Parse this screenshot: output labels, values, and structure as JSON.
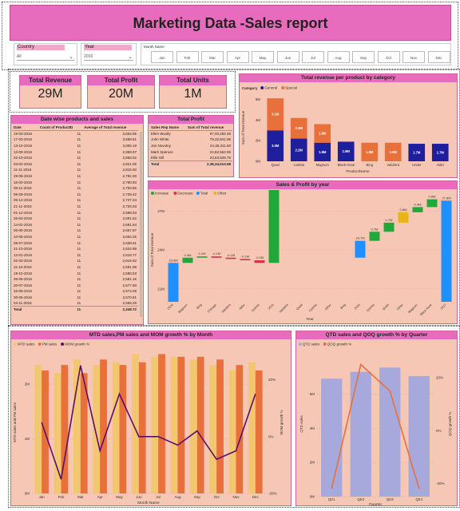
{
  "title": "Marketing Data -Sales report",
  "slicers": {
    "country": {
      "label": "Country",
      "value": "All"
    },
    "year": {
      "label": "Year",
      "value": "2016"
    },
    "month": {
      "label": "Month Name",
      "items": [
        "Jan",
        "Feb",
        "Mar",
        "Apr",
        "May",
        "Jun",
        "Jul",
        "Aug",
        "Sep",
        "Oct",
        "Nov",
        "Dec"
      ]
    }
  },
  "kpis": [
    {
      "label": "Total Revenue",
      "value": "29M"
    },
    {
      "label": "Total Profit",
      "value": "20M"
    },
    {
      "label": "Total Units",
      "value": "1M"
    }
  ],
  "date_table": {
    "title": "Date wise products and sales",
    "columns": [
      "Date",
      "Count of ProductID",
      "Average of Total revenue"
    ],
    "rows": [
      [
        "19-03-2016",
        "11",
        "3,664.55"
      ],
      [
        "17-03-2016",
        "11",
        "3,658.61"
      ],
      [
        "13-10-2016",
        "11",
        "3,006.19"
      ],
      [
        "13-09-2016",
        "11",
        "2,958.97"
      ],
      [
        "02-10-2016",
        "11",
        "2,858.02"
      ],
      [
        "03-02-2016",
        "11",
        "2,821.05"
      ],
      [
        "11-11-2016",
        "11",
        "2,815.50"
      ],
      [
        "29-08-2016",
        "11",
        "2,782.30"
      ],
      [
        "16-03-2016",
        "11",
        "2,780.93"
      ],
      [
        "08-11-2016",
        "11",
        "2,763.55"
      ],
      [
        "05-09-2016",
        "11",
        "2,739.42"
      ],
      [
        "05-12-2016",
        "11",
        "2,727.34"
      ],
      [
        "21-11-2016",
        "11",
        "2,726.03"
      ],
      [
        "01-12-2016",
        "11",
        "2,698.53"
      ],
      [
        "26-02-2016",
        "11",
        "2,691.52"
      ],
      [
        "14-01-2016",
        "11",
        "2,681.64"
      ],
      [
        "06-05-2016",
        "11",
        "2,667.87"
      ],
      [
        "10-05-2016",
        "11",
        "2,654.25"
      ],
      [
        "08-07-2016",
        "11",
        "2,638.61"
      ],
      [
        "21-10-2016",
        "11",
        "2,624.88"
      ],
      [
        "12-01-2016",
        "11",
        "2,619.77"
      ],
      [
        "02-03-2016",
        "11",
        "2,616.82"
      ],
      [
        "11-10-2016",
        "11",
        "2,591.08"
      ],
      [
        "19-10-2016",
        "11",
        "2,580.53"
      ],
      [
        "06-06-2016",
        "11",
        "2,581.16"
      ],
      [
        "20-07-2016",
        "11",
        "2,577.90"
      ],
      [
        "16-08-2016",
        "11",
        "2,574.08"
      ],
      [
        "30-05-2016",
        "11",
        "2,570.81"
      ],
      [
        "04-11-2016",
        "11",
        "2,566.29"
      ]
    ],
    "total": [
      "Total",
      "11",
      "2,348.72"
    ]
  },
  "profit_table": {
    "title": "Total Profit",
    "columns": [
      "Sales Rep Name",
      "Sum of Total revenue"
    ],
    "rows": [
      [
        "Ellen Woolly",
        "97,00,259.35"
      ],
      [
        "John White",
        "79,32,841.55"
      ],
      [
        "Jan Novotny",
        "24,35,311.60"
      ],
      [
        "Mark Spencer",
        "24,82,562.95"
      ],
      [
        "Ellie Gill",
        "23,63,528.75"
      ]
    ],
    "total": [
      "Total",
      "2,38,34,513.58"
    ]
  },
  "charts": {
    "category": {
      "title": "Total revenue per product by category",
      "legend_title": "Category",
      "legend": [
        "General",
        "Special"
      ],
      "xlabel": "ProductName",
      "ylabel": "Sum of Total revenue",
      "ticks": [
        "0M",
        "2M",
        "4M",
        "6M"
      ],
      "colors": {
        "General": "#1f1f9e",
        "Special": "#e8703a"
      }
    },
    "waterfall": {
      "title": "Sales & Profit by year",
      "legend": [
        "Increase",
        "Decrease",
        "Total",
        "Other"
      ],
      "xlabel": "Year",
      "ylabel": "Sum of Total revenue",
      "ticks": [
        "21M",
        "24M",
        "27M"
      ],
      "colors": {
        "Increase": "#22a839",
        "Decrease": "#d9334a",
        "Total": "#1e90ff",
        "Other": "#e8b41a"
      }
    },
    "month": {
      "title": "MTD sales,PM sales and MOM growth % by Month",
      "legend": [
        "MTD sales",
        "PM sales",
        "MOM growth %"
      ],
      "xlabel": "Month Name",
      "ylabel": "MTD sales and PM sales",
      "y2label": "MOM growth %",
      "ticks": [
        "0M",
        "1M",
        "2M"
      ],
      "ticks2": [
        "-20%",
        "0%",
        "20%"
      ],
      "colors": {
        "MTD sales": "#f2c770",
        "PM sales": "#e8703a",
        "MOM growth %": "#5a0f6e"
      }
    },
    "quarter": {
      "title": "QTD sales and QOQ growth % by Quarter",
      "legend": [
        "QTD sales",
        "QOQ growth %"
      ],
      "xlabel": "Quarter",
      "ylabel": "QTD sales",
      "y2label": "QOQ growth %",
      "ticks": [
        "0M",
        "2M",
        "4M",
        "6M"
      ],
      "ticks2": [
        "-20%",
        "0%",
        "20%"
      ],
      "colors": {
        "QTD sales": "#a7a9dd",
        "QOQ growth %": "#e8703a"
      }
    }
  },
  "chart_data": [
    {
      "type": "bar",
      "title": "Total revenue per product by category",
      "xlabel": "ProductName",
      "ylabel": "Sum of Total revenue",
      "categories": [
        "Quad",
        "Carlota",
        "Magnum",
        "Black Hook",
        "Bing",
        "Valcilera",
        "Under",
        "Alder"
      ],
      "series": [
        {
          "name": "General",
          "values": [
            3.0,
            2.2,
            1.8,
            1.9,
            0,
            0,
            1.7,
            1.7
          ],
          "labels": [
            "3.0M",
            "2.2M",
            "1.8M",
            "1.9M",
            "",
            "",
            "1.7M",
            "1.7M"
          ]
        },
        {
          "name": "Special",
          "values": [
            3.1,
            2.0,
            1.8,
            0,
            1.8,
            1.8,
            0,
            0
          ],
          "labels": [
            "3.1M",
            "2.0M",
            "1.8M",
            "",
            "1.8M",
            "1.8M",
            "",
            ""
          ]
        }
      ],
      "ylim": [
        0,
        6.5
      ],
      "stacked": true
    },
    {
      "type": "bar",
      "title": "Sales & Profit by year",
      "subtype": "waterfall",
      "xlabel": "Year",
      "ylabel": "Sum of Total revenue",
      "categories": [
        "2016",
        "Magnum",
        "Bing",
        "Chicago",
        "Valcilera",
        "Aldor",
        "Carlota",
        "2016 ",
        "Valcilera ",
        "Quad",
        "Carlota ",
        "Other",
        "Bing ",
        "2016  ",
        "Carlota  ",
        "Quad ",
        "Other ",
        "Magnum ",
        "Black Hook",
        "2017"
      ],
      "values": [
        23.0,
        0.4,
        0.1,
        -0.1,
        -0.1,
        -0.1,
        -0.2,
        23.6,
        0.4,
        0.2,
        0.3,
        0.1,
        -0.1,
        24.7,
        0.7,
        0.7,
        0.8,
        0.4,
        0.6,
        27.8
      ],
      "labels": [
        "23.0M",
        "0.4M",
        "0.1M",
        "-0.1M",
        "-0.1M",
        "-0.1M",
        "-0.2M",
        "23.6M",
        "0.4M",
        "0.2M",
        "0.3M",
        "0.1M",
        "-0.1M",
        "24.7M",
        "0.7M",
        "0.7M",
        "0.8M",
        "0.4M",
        "0.6M",
        "27.8M"
      ],
      "kinds": [
        "Total",
        "Increase",
        "Increase",
        "Decrease",
        "Decrease",
        "Decrease",
        "Decrease",
        "Increase",
        "Increase",
        "Increase",
        "Increase",
        "Increase",
        "Decrease",
        "Total",
        "Increase",
        "Increase",
        "Other",
        "Increase",
        "Increase",
        "Total"
      ],
      "ylim": [
        20,
        28
      ]
    },
    {
      "type": "bar",
      "title": "MTD sales,PM sales and MOM growth % by Month",
      "xlabel": "Month Name",
      "ylabel": "MTD sales and PM sales",
      "categories": [
        "Jan",
        "Feb",
        "Mar",
        "Apr",
        "May",
        "Jun",
        "Jul",
        "Aug",
        "Sep",
        "Oct",
        "Nov",
        "Dec"
      ],
      "series": [
        {
          "name": "MTD sales",
          "values": [
            2.35,
            2.2,
            2.45,
            2.35,
            2.4,
            2.55,
            2.5,
            2.5,
            2.45,
            2.35,
            2.25,
            2.4
          ]
        },
        {
          "name": "PM sales",
          "values": [
            2.25,
            2.35,
            2.2,
            2.45,
            2.35,
            2.4,
            2.55,
            2.5,
            2.5,
            2.45,
            2.35,
            2.25
          ]
        },
        {
          "name": "MOM growth %",
          "values": [
            5,
            -15,
            25,
            -5,
            15,
            0,
            0,
            -3,
            2,
            -8,
            -5,
            15
          ],
          "axis": "y2"
        }
      ],
      "ylim": [
        0,
        2.6
      ],
      "y2lim": [
        -20,
        30
      ]
    },
    {
      "type": "bar",
      "title": "QTD sales and QOQ growth % by Quarter",
      "xlabel": "Quarter",
      "ylabel": "QTD sales",
      "categories": [
        "Qtr1",
        "Qtr2",
        "Qtr3",
        "Qtr4"
      ],
      "series": [
        {
          "name": "QTD sales",
          "values": [
            6.9,
            7.3,
            7.55,
            7.05
          ]
        },
        {
          "name": "QOQ growth %",
          "values": [
            -22,
            25,
            15,
            -22
          ],
          "axis": "y2"
        }
      ],
      "ylim": [
        0,
        8.5
      ],
      "y2lim": [
        -25,
        30
      ]
    }
  ]
}
